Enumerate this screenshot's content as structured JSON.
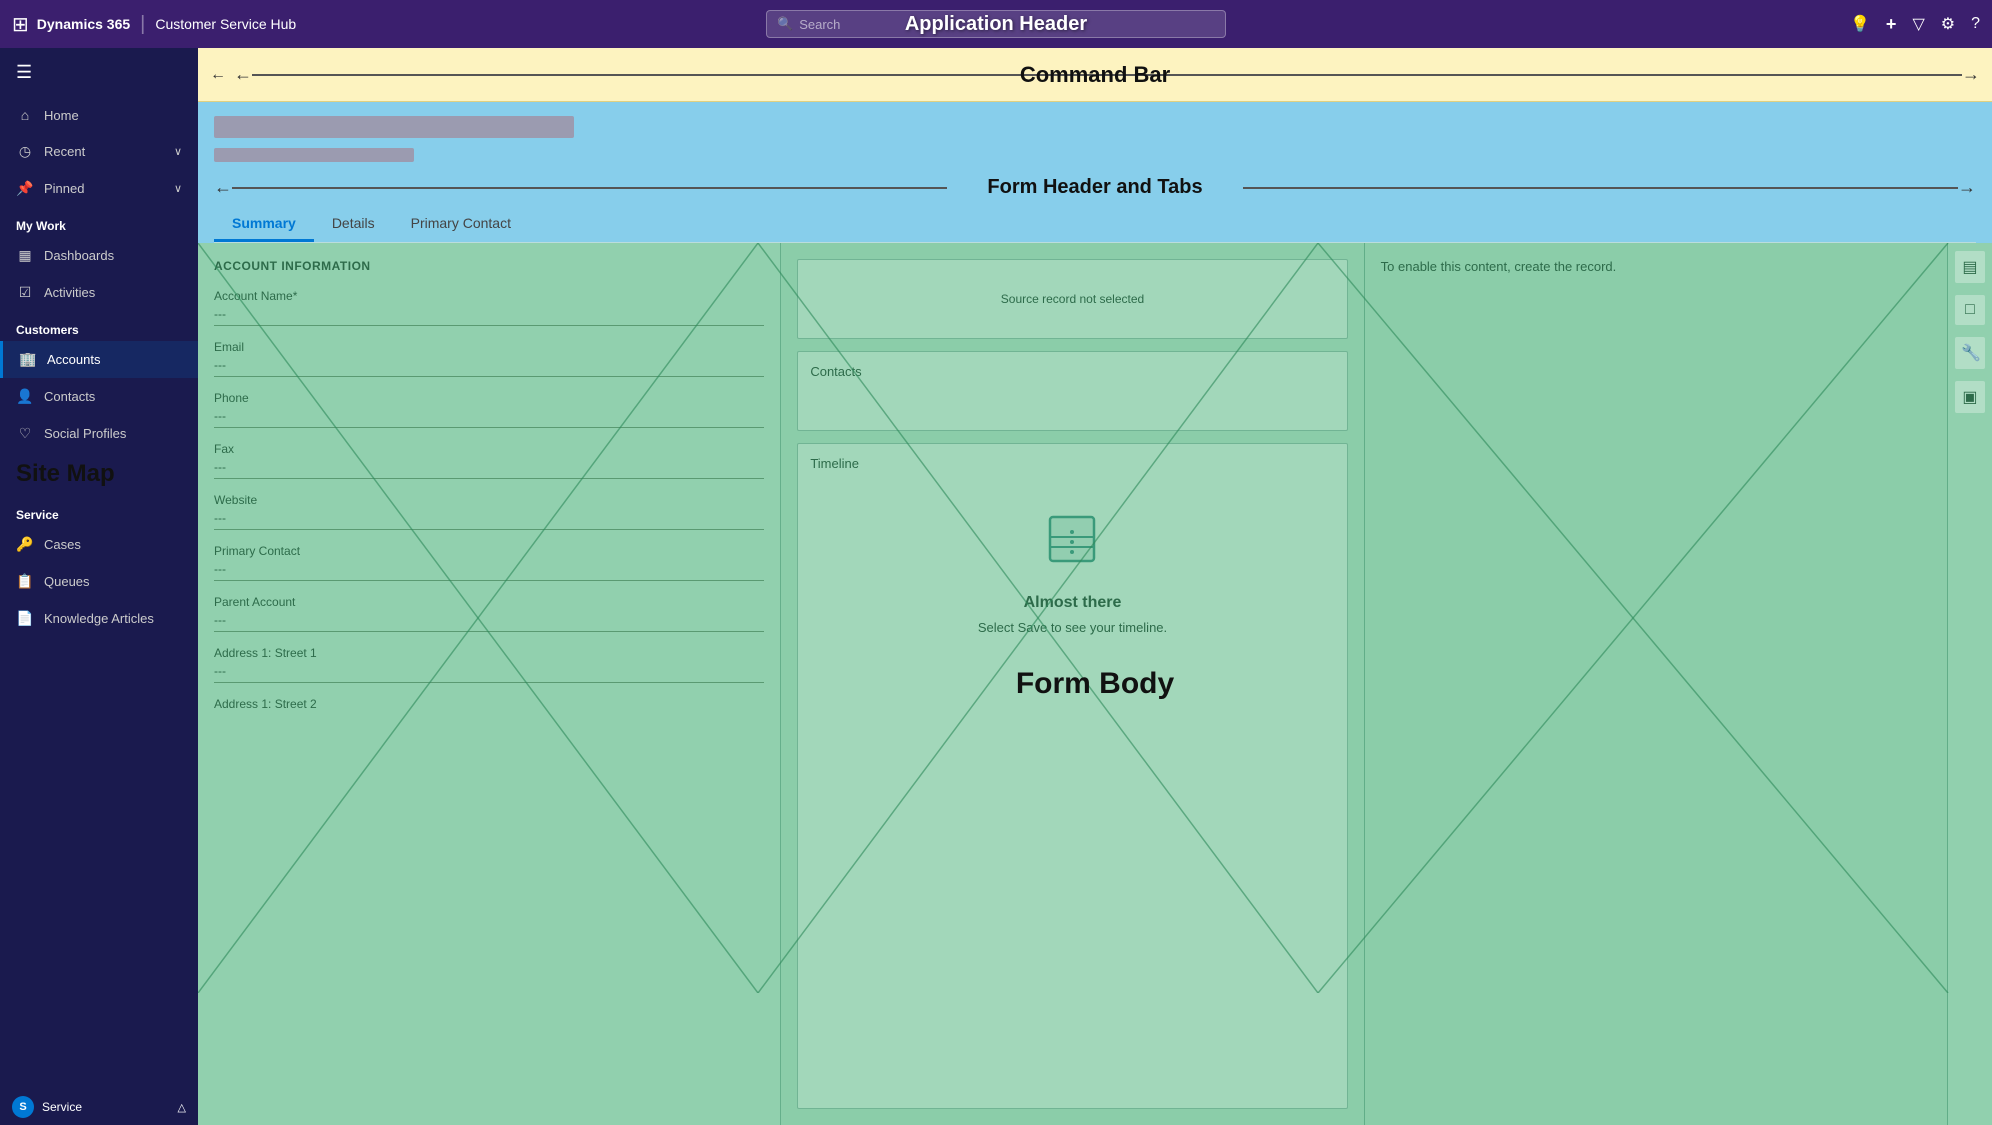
{
  "app_header": {
    "waffle_icon": "⊞",
    "app_name": "Dynamics 365",
    "divider": "|",
    "hub_name": "Customer Service Hub",
    "search_placeholder": "Search",
    "label": "Application Header",
    "icons": {
      "lightbulb": "💡",
      "plus": "+",
      "filter": "⚙",
      "settings": "⚙",
      "help": "?"
    }
  },
  "command_bar": {
    "label": "Command Bar",
    "back_icon": "←"
  },
  "form_header": {
    "label": "Form Header and Tabs",
    "tabs": [
      {
        "id": "summary",
        "label": "Summary",
        "active": true
      },
      {
        "id": "details",
        "label": "Details",
        "active": false
      },
      {
        "id": "primary_contact",
        "label": "Primary Contact",
        "active": false
      }
    ]
  },
  "form_body": {
    "label": "Form Body",
    "left_section": {
      "title": "ACCOUNT INFORMATION",
      "fields": [
        {
          "label": "Account Name*",
          "value": "---"
        },
        {
          "label": "Email",
          "value": "---"
        },
        {
          "label": "Phone",
          "value": "---"
        },
        {
          "label": "Fax",
          "value": "---"
        },
        {
          "label": "Website",
          "value": "---"
        },
        {
          "label": "Primary Contact",
          "value": "---"
        },
        {
          "label": "Parent Account",
          "value": "---"
        },
        {
          "label": "Address 1: Street 1",
          "value": "---"
        },
        {
          "label": "Address 1: Street 2",
          "value": "---"
        }
      ]
    },
    "middle_section": {
      "source_record": {
        "text": "Source record not selected"
      },
      "contacts_card": {
        "title": "Contacts"
      },
      "timeline_card": {
        "title": "Timeline",
        "icon": "🗂",
        "almost_there": "Almost there",
        "sub_text": "Select Save to see your timeline."
      }
    },
    "right_section": {
      "enable_text": "To enable this content, create the record.",
      "icons": [
        "▤",
        "□",
        "🔧",
        "▣"
      ]
    }
  },
  "sidebar": {
    "toggle_icon": "☰",
    "nav_items": [
      {
        "id": "home",
        "icon": "⌂",
        "label": "Home"
      },
      {
        "id": "recent",
        "icon": "◷",
        "label": "Recent",
        "expandable": true
      },
      {
        "id": "pinned",
        "icon": "📌",
        "label": "Pinned",
        "expandable": true
      }
    ],
    "sections": [
      {
        "id": "my-work",
        "label": "My Work",
        "items": [
          {
            "id": "dashboards",
            "icon": "▦",
            "label": "Dashboards"
          },
          {
            "id": "activities",
            "icon": "☑",
            "label": "Activities"
          }
        ]
      },
      {
        "id": "customers",
        "label": "Customers",
        "items": [
          {
            "id": "accounts",
            "icon": "🏢",
            "label": "Accounts",
            "active": true
          },
          {
            "id": "contacts",
            "icon": "👤",
            "label": "Contacts"
          },
          {
            "id": "social-profiles",
            "icon": "♡",
            "label": "Social Profiles"
          }
        ]
      },
      {
        "id": "service",
        "label": "Service",
        "items": [
          {
            "id": "cases",
            "icon": "🔑",
            "label": "Cases"
          },
          {
            "id": "queues",
            "icon": "📋",
            "label": "Queues"
          },
          {
            "id": "knowledge-articles",
            "icon": "📄",
            "label": "Knowledge Articles"
          }
        ]
      }
    ],
    "site_map_label": "Site Map"
  },
  "bottom_bar": {
    "icon": "S",
    "text": "Service",
    "expand_icon": "△"
  }
}
